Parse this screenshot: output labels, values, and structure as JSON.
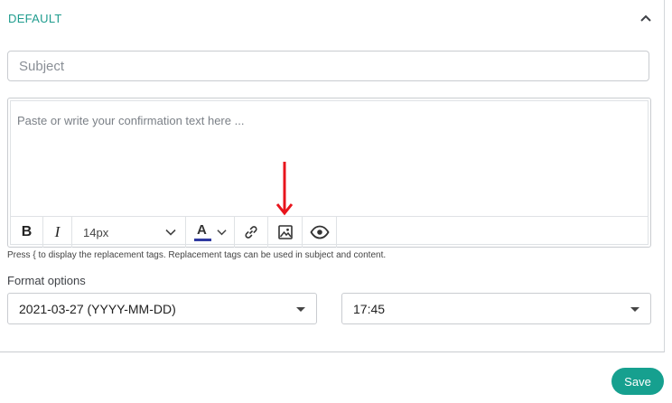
{
  "section": {
    "title": "DEFAULT"
  },
  "subject": {
    "placeholder": "Subject",
    "value": ""
  },
  "editor": {
    "placeholder": "Paste or write your confirmation text here ...",
    "toolbar": {
      "bold_label": "B",
      "italic_label": "I",
      "font_size": "14px",
      "text_color_label": "A",
      "text_color": "#2f3aa1"
    }
  },
  "hint": "Press { to display the replacement tags. Replacement tags can be used in subject and content.",
  "format": {
    "label": "Format options",
    "date_format": "2021-03-27 (YYYY-MM-DD)",
    "time_format": "17:45"
  },
  "save_label": "Save",
  "colors": {
    "accent": "#16a08f",
    "annotation": "#e8141c"
  }
}
